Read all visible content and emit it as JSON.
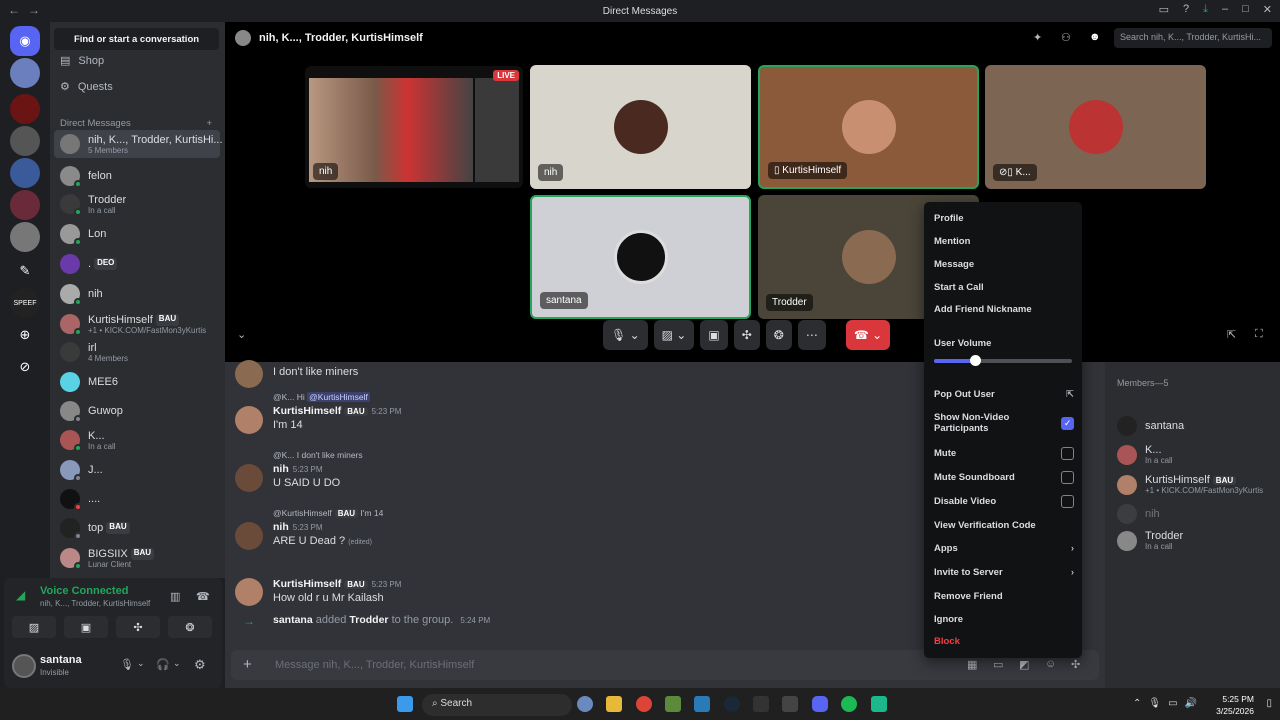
{
  "window": {
    "title": "Direct Messages"
  },
  "dm_sidebar": {
    "find_button": "Find or start a conversation",
    "nav": [
      {
        "label": "Shop",
        "icon": "shop-icon"
      },
      {
        "label": "Quests",
        "icon": "quests-icon"
      }
    ],
    "dm_header": "Direct Messages",
    "add_dm": "+",
    "items": [
      {
        "name": "nih, K..., Trodder, KurtisHi...",
        "sub": "5 Members",
        "active": true
      },
      {
        "name": "felon",
        "sub": ""
      },
      {
        "name": "Trodder",
        "sub": "In a call"
      },
      {
        "name": "Lon",
        "sub": ""
      },
      {
        "name": ".",
        "sub": "",
        "tag": "DEO"
      },
      {
        "name": "nih",
        "sub": ""
      },
      {
        "name": "KurtisHimself",
        "sub": "+1 • KICK.COM/FastMon3yKurtis",
        "tag": "BAU"
      },
      {
        "name": "irl",
        "sub": "4 Members"
      },
      {
        "name": "MEE6",
        "sub": ""
      },
      {
        "name": "Guwop",
        "sub": ""
      },
      {
        "name": "K...",
        "sub": "In a call"
      },
      {
        "name": "J...",
        "sub": ""
      },
      {
        "name": "....",
        "sub": ""
      },
      {
        "name": "top",
        "sub": "",
        "tag": "BAU"
      },
      {
        "name": "BIGSIIX",
        "sub": "Lunar Client",
        "tag": "BAU"
      }
    ]
  },
  "voice_panel": {
    "status": "Voice Connected",
    "channel": "nih, K..., Trodder, KurtisHimself",
    "user_name": "santana",
    "user_status": "Invisible"
  },
  "call": {
    "title": "nih, K..., Trodder, KurtisHimself",
    "search_placeholder": "Search nih, K..., Trodder, KurtisHi...",
    "live_badge": "LIVE",
    "tiles": [
      {
        "label": "nih",
        "kind": "stream"
      },
      {
        "label": "nih",
        "kind": "camera"
      },
      {
        "label": "KurtisHimself",
        "kind": "camera"
      },
      {
        "label": "K...",
        "kind": "camera"
      },
      {
        "label": "santana",
        "kind": "avatar"
      },
      {
        "label": "Trodder",
        "kind": "avatar"
      }
    ]
  },
  "messages": [
    {
      "reply": "",
      "name": "",
      "time": "",
      "text": "I don't like miners"
    },
    {
      "reply_user": "@K...",
      "reply": "Hi",
      "reply_mention": "@KurtisHimself",
      "name": "KurtisHimself",
      "tag": "BAU",
      "time": "5:23 PM",
      "text": "I'm 14"
    },
    {
      "reply_user": "@K...",
      "reply": "I don't like miners",
      "name": "nih",
      "time": "5:23 PM",
      "text": "U SAID U DO"
    },
    {
      "reply_user": "@KurtisHimself",
      "reply_tag": "BAU",
      "reply": "I'm 14",
      "name": "nih",
      "time": "5:23 PM",
      "text": "ARE U Dead ?",
      "edited": "(edited)"
    },
    {
      "name": "KurtisHimself",
      "tag": "BAU",
      "time": "5:23 PM",
      "text": "How old r u Mr Kailash"
    },
    {
      "system_actor": "santana",
      "system_action": "added",
      "system_target": "Trodder",
      "system_suffix": "to the group.",
      "time": "5:24 PM"
    }
  ],
  "compose_placeholder": "Message nih, K..., Trodder, KurtisHimself",
  "members": {
    "header": "Members—5",
    "list": [
      {
        "name": "santana",
        "sub": ""
      },
      {
        "name": "K...",
        "sub": "In a call"
      },
      {
        "name": "KurtisHimself",
        "sub": "+1 • KICK.COM/FastMon3yKurtis",
        "tag": "BAU"
      },
      {
        "name": "nih",
        "sub": ""
      },
      {
        "name": "Trodder",
        "sub": "In a call"
      }
    ]
  },
  "context_menu": {
    "items": [
      "Profile",
      "Mention",
      "Message",
      "Start a Call",
      "Add Friend Nickname"
    ],
    "user_volume_label": "User Volume",
    "user_volume_fraction": 0.3,
    "pop_out": "Pop Out User",
    "show_non_video": "Show Non-Video Participants",
    "show_non_video_checked": true,
    "mute": "Mute",
    "mute_soundboard": "Mute Soundboard",
    "disable_video": "Disable Video",
    "view_verification": "View Verification Code",
    "apps": "Apps",
    "invite": "Invite to Server",
    "remove_friend": "Remove Friend",
    "ignore": "Ignore",
    "block": "Block"
  },
  "taskbar": {
    "search": "Search",
    "time": "5:25 PM",
    "date": "3/25/2026"
  },
  "colors": {
    "accent": "#5865f2",
    "online": "#23a55a",
    "danger": "#da373c",
    "block": "#f23f43"
  }
}
